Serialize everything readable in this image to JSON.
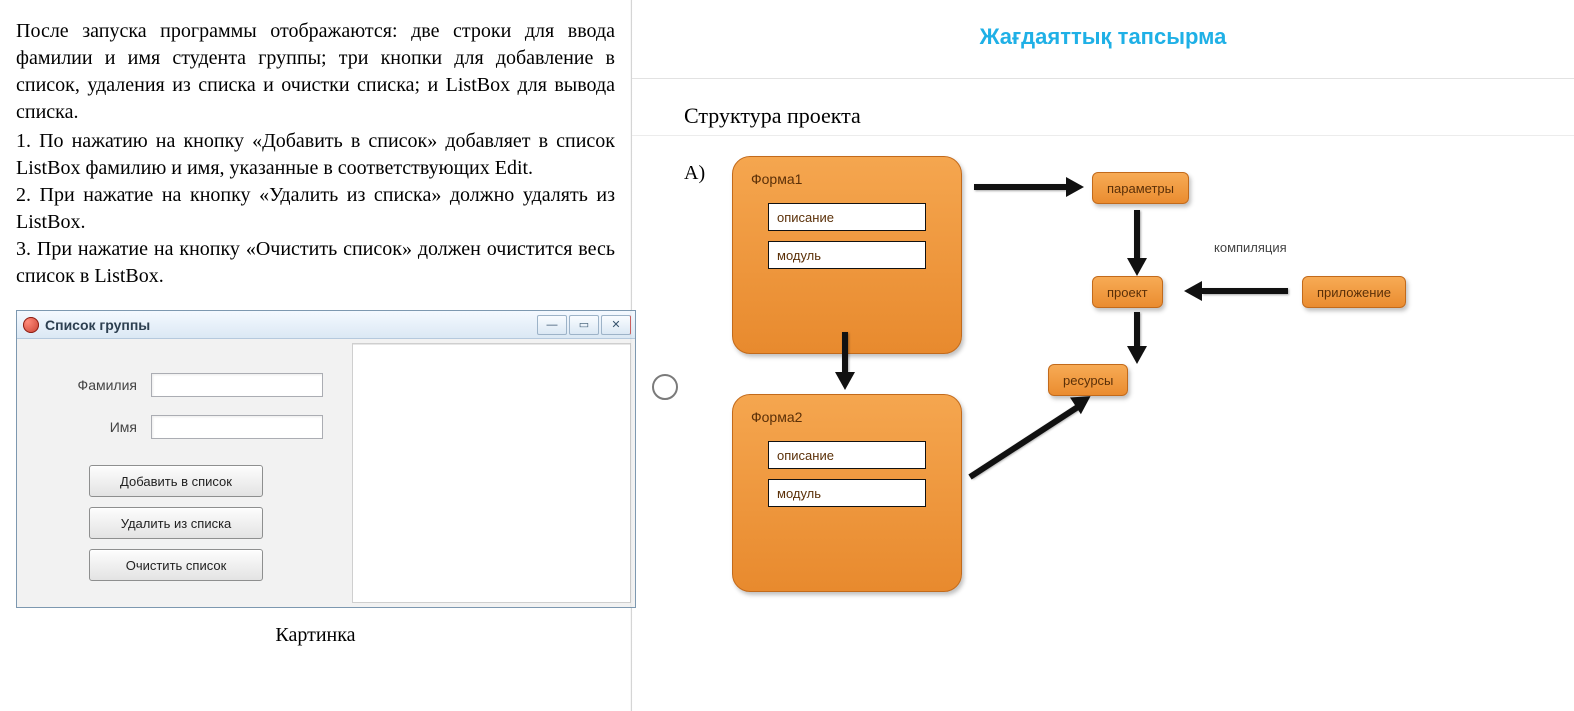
{
  "left": {
    "para": "После запуска программы отображаются: две строки для ввода фамилии и имя студента группы; три кнопки для добавление в список, удаления из списка и очистки списка;  и ListBox для вывода списка.",
    "steps": [
      "1.        По нажатию на кнопку «Добавить в список» добавляет в список ListBox фамилию и имя, указанные в соответствующих Edit.",
      "2.        При нажатие на кнопку «Удалить из списка» должно удалять из ListBox.",
      "3.        При нажатие на кнопку «Очистить список» должен очистится весь список в ListBox."
    ],
    "caption": "Картинка"
  },
  "app_window": {
    "title": "Список группы",
    "labels": {
      "surname": "Фамилия",
      "name": "Имя"
    },
    "buttons": {
      "add": "Добавить в список",
      "del": "Удалить из списка",
      "clear": "Очистить список"
    }
  },
  "right": {
    "header": "Жағдаяттық тапсырма",
    "subtitle": "Структура проекта",
    "option_label": "А)",
    "form1": {
      "title": "Форма1",
      "f1": "описание",
      "f2": "модуль"
    },
    "form2": {
      "title": "Форма2",
      "f1": "описание",
      "f2": "модуль"
    },
    "boxes": {
      "param": "параметры",
      "project": "проект",
      "resources": "ресурсы",
      "app": "приложение"
    },
    "annot_compilation": "компиляция"
  }
}
